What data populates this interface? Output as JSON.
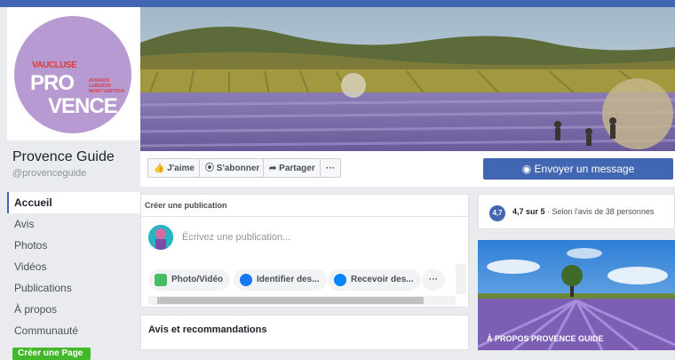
{
  "logo": {
    "line1": "VAUCLUSE",
    "line2": "PRO",
    "line3": "VENCE",
    "sub": [
      "AVIGNON",
      "LUBERON",
      "MONT-VENTOUX"
    ]
  },
  "page": {
    "name": "Provence Guide",
    "handle": "@provenceguide"
  },
  "nav": {
    "items": [
      {
        "label": "Accueil"
      },
      {
        "label": "Avis"
      },
      {
        "label": "Photos"
      },
      {
        "label": "Vidéos"
      },
      {
        "label": "Publications"
      },
      {
        "label": "À propos"
      },
      {
        "label": "Communauté"
      }
    ],
    "create_page": "Créer une Page"
  },
  "actions": {
    "like": "J'aime",
    "follow": "S'abonner",
    "share": "Partager",
    "more": "···",
    "message": "Envoyer un message"
  },
  "create_post": {
    "title": "Créer une publication",
    "placeholder": "Écrivez une publication...",
    "chips": [
      {
        "label": "Photo/Vidéo"
      },
      {
        "label": "Identifier des..."
      },
      {
        "label": "Recevoir des..."
      }
    ],
    "more": "···"
  },
  "reviews": {
    "title": "Avis et recommandations"
  },
  "rating": {
    "badge": "4,7",
    "score": "4,7 sur 5",
    "detail": " · Selon l'avis de 38 personnes"
  },
  "about": {
    "label": "À PROPOS PROVENCE GUIDE"
  },
  "colors": {
    "brand": "#4267b2",
    "lavender": "#b79ad2"
  }
}
